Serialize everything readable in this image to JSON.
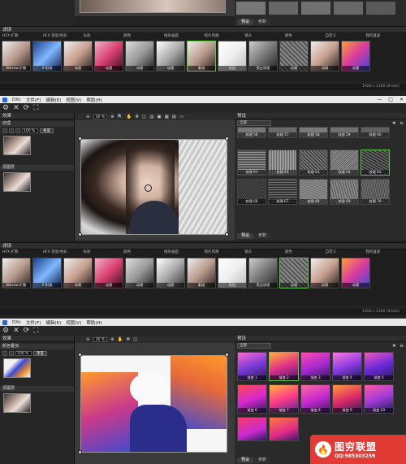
{
  "menu": {
    "app": "DXc",
    "items": [
      "文件(F)",
      "编辑(E)",
      "视图(V)",
      "帮助(H)"
    ]
  },
  "window_controls": [
    "—",
    "□",
    "✕"
  ],
  "toolbar": {
    "icons": [
      "gear-icon",
      "close-icon",
      "refresh-icon",
      "fit-icon"
    ]
  },
  "sidebar": {
    "title": "效果",
    "layer1": {
      "name": "纹理",
      "opacity": "100 %",
      "reset": "重置"
    },
    "layer2": {
      "name": "源图层"
    },
    "layer1_alt": "颜色叠加"
  },
  "view": {
    "zoom": "36 %"
  },
  "presets": {
    "title": "预设",
    "dropdown": "全部",
    "tabs": [
      "预设",
      "参数"
    ],
    "textures_row1": [
      "纹理 56",
      "纹理 57",
      "纹理 58",
      "纹理 59",
      "纹理 60"
    ],
    "textures_row2": [
      "纹理 61",
      "纹理 62",
      "纹理 63",
      "纹理 64",
      "纹理 65"
    ],
    "textures_row3": [
      "纹理 66",
      "纹理 67",
      "纹理 68",
      "纹理 69",
      "纹理 70"
    ],
    "gradient_row1": [
      "渐变 1",
      "渐变 2",
      "渐变 3",
      "渐变 4",
      "渐变 5"
    ],
    "gradient_row2": [
      "渐变 6",
      "渐变 7",
      "渐变 8",
      "渐变 9",
      "渐变 10"
    ]
  },
  "filters": {
    "title": "滤镜",
    "categories": [
      "HFX 扩散",
      "HFX 渐变/色彩",
      "光效",
      "颜色",
      "线条画面",
      "照片风格",
      "镜头",
      "颜色",
      "自定义",
      "我的喜爱"
    ],
    "thumbs": [
      "Narrow 扩散",
      "X 射线",
      "动感",
      "动感",
      "动感",
      "动感",
      "素描",
      "仿旧",
      "黑白质感",
      "动感",
      "动感",
      "动感"
    ]
  },
  "status": {
    "size": "1920 x 1200 (8 bits)"
  },
  "watermark": {
    "brand": "图穷联盟",
    "qq": "QQ:985303259"
  },
  "colors": {
    "accent_green": "#5ec74a",
    "panel": "#232323"
  }
}
